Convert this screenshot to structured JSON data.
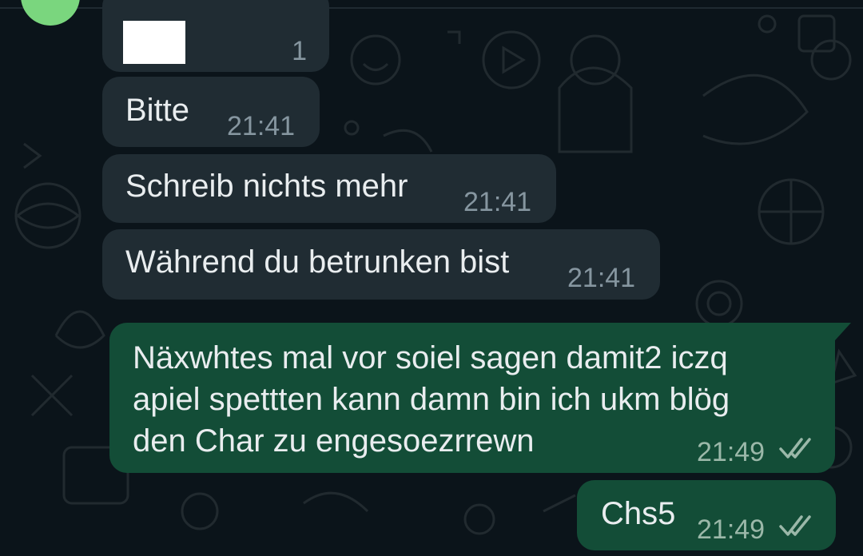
{
  "app": "WhatsApp",
  "colors": {
    "background": "#0b141a",
    "incoming_bubble": "#202c33",
    "outgoing_bubble": "#134d37",
    "text": "#e9edef",
    "timestamp": "#8696a0",
    "avatar": "#7ad67e"
  },
  "messages": [
    {
      "direction": "incoming",
      "text": "",
      "time": "1",
      "redacted": true
    },
    {
      "direction": "incoming",
      "text": "Bitte",
      "time": "21:41"
    },
    {
      "direction": "incoming",
      "text": "Schreib nichts mehr",
      "time": "21:41"
    },
    {
      "direction": "incoming",
      "text": "Während du betrunken bist",
      "time": "21:41"
    },
    {
      "direction": "outgoing",
      "text": "Näxwhtes mal vor soiel sagen damit2 iczq\napiel spettten kann damn bin ich ukm blög\nden Char zu engesoezrrewn",
      "time": "21:49",
      "status_icon": "double-check-icon"
    },
    {
      "direction": "outgoing",
      "text": "Chs5",
      "time": "21:49",
      "status_icon": "double-check-icon"
    }
  ]
}
